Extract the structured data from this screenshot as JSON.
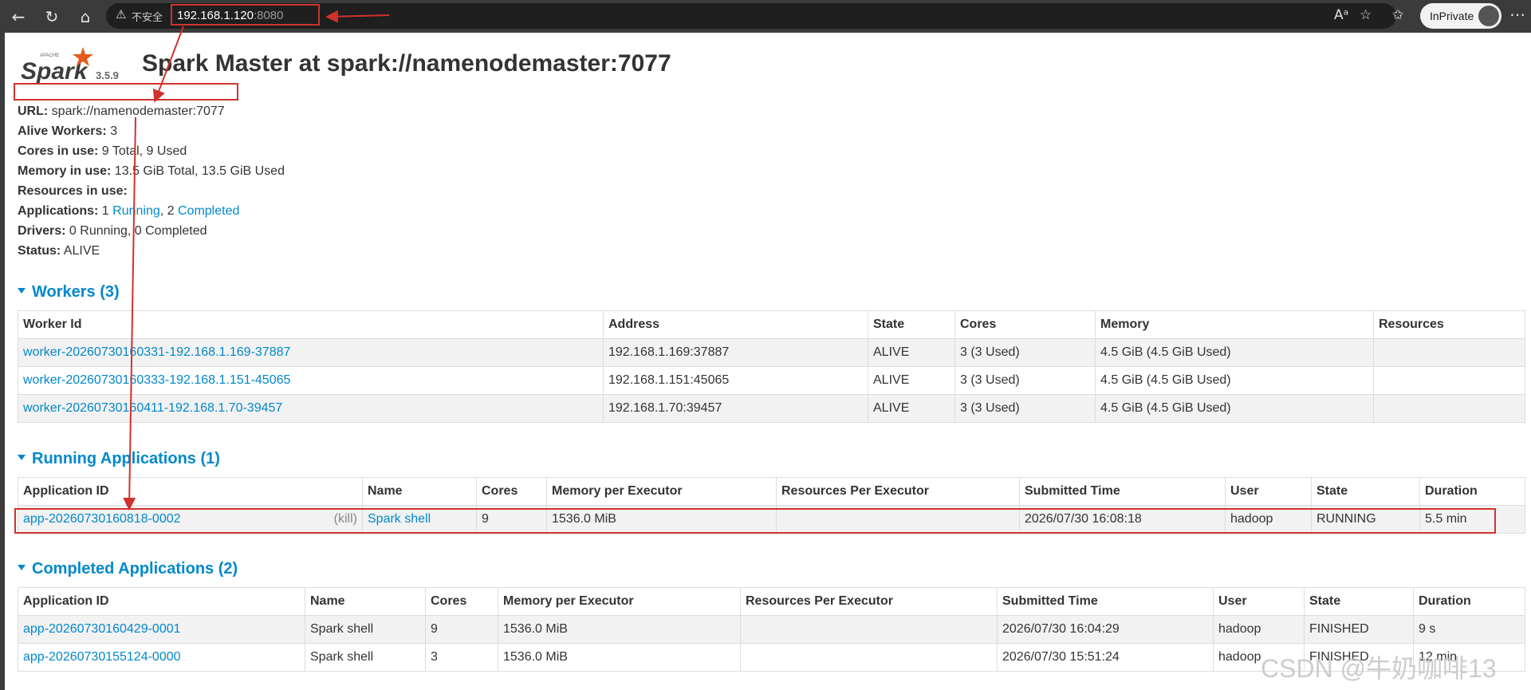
{
  "browser": {
    "insecure_label": "不安全",
    "url_host": "192.168.1.120",
    "url_port": ":8080",
    "inprivate_label": "InPrivate"
  },
  "header": {
    "version": "3.5.9",
    "title": "Spark Master at spark://namenodemaster:7077"
  },
  "info": {
    "url_label": "URL:",
    "url_value": " spark://namenodemaster:7077",
    "alive_label": "Alive Workers:",
    "alive_value": " 3",
    "cores_label": "Cores in use:",
    "cores_value": " 9 Total, 9 Used",
    "memory_label": "Memory in use:",
    "memory_value": " 13.5 GiB Total, 13.5 GiB Used",
    "resources_label": "Resources in use:",
    "apps_label": "Applications:",
    "apps_running_count": " 1 ",
    "apps_running_link": "Running",
    "apps_sep": ", 2 ",
    "apps_completed_link": "Completed",
    "drivers_label": "Drivers:",
    "drivers_value": " 0 Running, 0 Completed",
    "status_label": "Status:",
    "status_value": " ALIVE"
  },
  "workers": {
    "heading": "Workers (3)",
    "columns": [
      "Worker Id",
      "Address",
      "State",
      "Cores",
      "Memory",
      "Resources"
    ],
    "rows": [
      [
        "worker-20260730160331-192.168.1.169-37887",
        "192.168.1.169:37887",
        "ALIVE",
        "3 (3 Used)",
        "4.5 GiB (4.5 GiB Used)",
        ""
      ],
      [
        "worker-20260730160333-192.168.1.151-45065",
        "192.168.1.151:45065",
        "ALIVE",
        "3 (3 Used)",
        "4.5 GiB (4.5 GiB Used)",
        ""
      ],
      [
        "worker-20260730160411-192.168.1.70-39457",
        "192.168.1.70:39457",
        "ALIVE",
        "3 (3 Used)",
        "4.5 GiB (4.5 GiB Used)",
        ""
      ]
    ]
  },
  "running": {
    "heading": "Running Applications (1)",
    "columns": [
      "Application ID",
      "Name",
      "Cores",
      "Memory per Executor",
      "Resources Per Executor",
      "Submitted Time",
      "User",
      "State",
      "Duration"
    ],
    "kill_label": "(kill)",
    "rows": [
      [
        "app-20260730160818-0002",
        "Spark shell",
        "9",
        "1536.0 MiB",
        "",
        "2026/07/30 16:08:18",
        "hadoop",
        "RUNNING",
        "5.5 min"
      ]
    ]
  },
  "completed": {
    "heading": "Completed Applications (2)",
    "columns": [
      "Application ID",
      "Name",
      "Cores",
      "Memory per Executor",
      "Resources Per Executor",
      "Submitted Time",
      "User",
      "State",
      "Duration"
    ],
    "rows": [
      [
        "app-20260730160429-0001",
        "Spark shell",
        "9",
        "1536.0 MiB",
        "",
        "2026/07/30 16:04:29",
        "hadoop",
        "FINISHED",
        "9 s"
      ],
      [
        "app-20260730155124-0000",
        "Spark shell",
        "3",
        "1536.0 MiB",
        "",
        "2026/07/30 15:51:24",
        "hadoop",
        "FINISHED",
        "12 min"
      ]
    ]
  },
  "watermark": "CSDN @牛奶咖啡13",
  "colors": {
    "link": "#0088cc",
    "annotation": "#d0322d"
  }
}
